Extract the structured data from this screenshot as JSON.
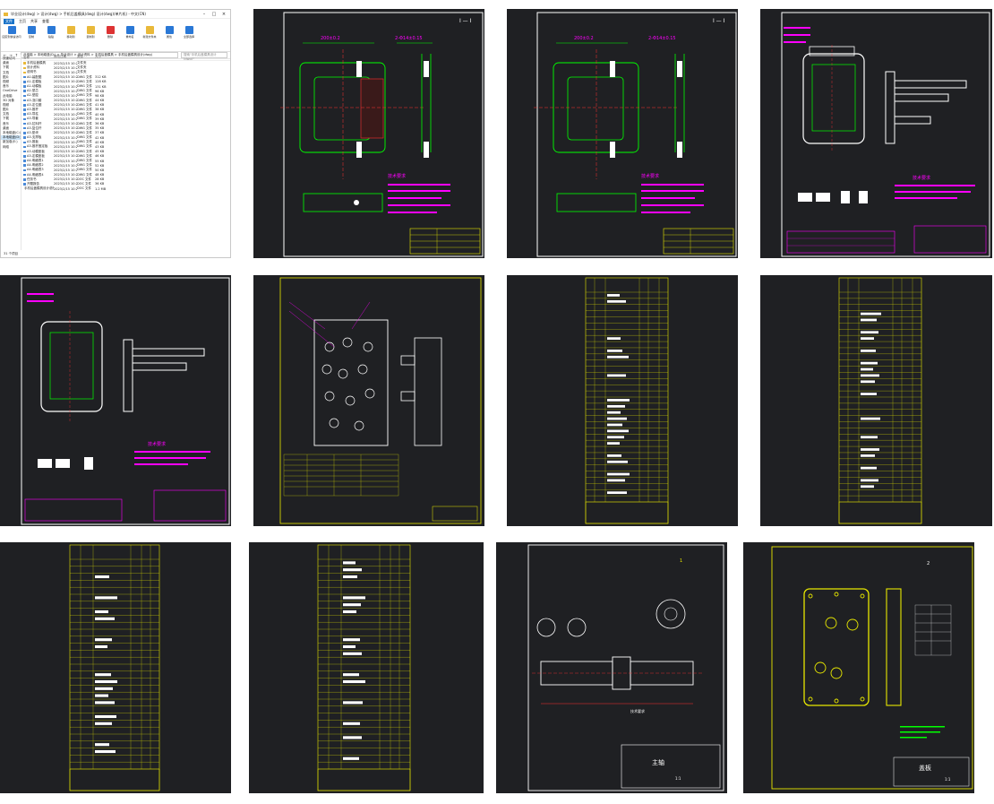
{
  "explorer": {
    "title": "毕业设计(dwg) > 设计(dwg) > 手机后盖模具(dwg) 设计(dwg)(单片机) - 中文(CN)",
    "menu": [
      "文件",
      "主页",
      "共享",
      "查看"
    ],
    "ribbon": [
      "固定到快速访问",
      "复制",
      "粘贴",
      "移动到",
      "复制到",
      "删除",
      "重命名",
      "新建文件夹",
      "属性",
      "全部选择"
    ],
    "address": "此电脑 > 本地磁盘(D:) > 毕业设计 > 设计资料 > 手机后盖模具 > 手机后盖模具设计(dwg)",
    "search_placeholder": "搜索\"手机后盖模具设计(dwg)\"",
    "columns": [
      "名称",
      "修改日期",
      "类型",
      "大小"
    ],
    "nav": [
      "快速访问",
      "桌面",
      "下载",
      "文档",
      "图片",
      "视频",
      "音乐",
      "OneDrive",
      "此电脑",
      "3D 对象",
      "视频",
      "图片",
      "文档",
      "下载",
      "音乐",
      "桌面",
      "本地磁盘(C:)",
      "本地磁盘(D:)",
      "新加卷(E:)",
      "网络"
    ],
    "files": [
      {
        "name": "手机后盖模具",
        "date": "2023/2/15 10:21",
        "type": "文件夹",
        "size": "",
        "kind": "folder"
      },
      {
        "name": "设计资料",
        "date": "2023/2/15 10:21",
        "type": "文件夹",
        "size": "",
        "kind": "folder"
      },
      {
        "name": "说明书",
        "date": "2023/2/15 10:21",
        "type": "文件夹",
        "size": "",
        "kind": "folder"
      },
      {
        "name": "A0-装配图",
        "date": "2023/2/15 10:21",
        "type": "DWG 文件",
        "size": "312 KB",
        "kind": "dwg"
      },
      {
        "name": "A1-定模板",
        "date": "2023/2/15 10:21",
        "type": "DWG 文件",
        "size": "128 KB",
        "kind": "dwg"
      },
      {
        "name": "A1-动模板",
        "date": "2023/2/15 10:21",
        "type": "DWG 文件",
        "size": "131 KB",
        "kind": "dwg"
      },
      {
        "name": "A2-型芯",
        "date": "2023/2/15 10:21",
        "type": "DWG 文件",
        "size": "96 KB",
        "kind": "dwg"
      },
      {
        "name": "A2-型腔",
        "date": "2023/2/15 10:21",
        "type": "DWG 文件",
        "size": "98 KB",
        "kind": "dwg"
      },
      {
        "name": "A3-浇口套",
        "date": "2023/2/15 10:21",
        "type": "DWG 文件",
        "size": "44 KB",
        "kind": "dwg"
      },
      {
        "name": "A3-定位圈",
        "date": "2023/2/15 10:21",
        "type": "DWG 文件",
        "size": "41 KB",
        "kind": "dwg"
      },
      {
        "name": "A3-推杆",
        "date": "2023/2/15 10:21",
        "type": "DWG 文件",
        "size": "38 KB",
        "kind": "dwg"
      },
      {
        "name": "A3-导柱",
        "date": "2023/2/15 10:21",
        "type": "DWG 文件",
        "size": "40 KB",
        "kind": "dwg"
      },
      {
        "name": "A3-导套",
        "date": "2023/2/15 10:21",
        "type": "DWG 文件",
        "size": "39 KB",
        "kind": "dwg"
      },
      {
        "name": "A3-拉料杆",
        "date": "2023/2/15 10:21",
        "type": "DWG 文件",
        "size": "36 KB",
        "kind": "dwg"
      },
      {
        "name": "A3-复位杆",
        "date": "2023/2/15 10:21",
        "type": "DWG 文件",
        "size": "35 KB",
        "kind": "dwg"
      },
      {
        "name": "A3-垫块",
        "date": "2023/2/15 10:21",
        "type": "DWG 文件",
        "size": "37 KB",
        "kind": "dwg"
      },
      {
        "name": "A3-支撑板",
        "date": "2023/2/15 10:21",
        "type": "DWG 文件",
        "size": "42 KB",
        "kind": "dwg"
      },
      {
        "name": "A3-推板",
        "date": "2023/2/15 10:21",
        "type": "DWG 文件",
        "size": "40 KB",
        "kind": "dwg"
      },
      {
        "name": "A3-推杆固定板",
        "date": "2023/2/15 10:21",
        "type": "DWG 文件",
        "size": "43 KB",
        "kind": "dwg"
      },
      {
        "name": "A3-动模座板",
        "date": "2023/2/15 10:21",
        "type": "DWG 文件",
        "size": "45 KB",
        "kind": "dwg"
      },
      {
        "name": "A3-定模座板",
        "date": "2023/2/15 10:21",
        "type": "DWG 文件",
        "size": "46 KB",
        "kind": "dwg"
      },
      {
        "name": "A4-明细表1",
        "date": "2023/2/15 10:21",
        "type": "DWG 文件",
        "size": "55 KB",
        "kind": "dwg"
      },
      {
        "name": "A4-明细表2",
        "date": "2023/2/15 10:21",
        "type": "DWG 文件",
        "size": "52 KB",
        "kind": "dwg"
      },
      {
        "name": "A4-明细表3",
        "date": "2023/2/15 10:21",
        "type": "DWG 文件",
        "size": "50 KB",
        "kind": "dwg"
      },
      {
        "name": "A4-明细表4",
        "date": "2023/2/15 10:21",
        "type": "DWG 文件",
        "size": "48 KB",
        "kind": "dwg"
      },
      {
        "name": "任务书",
        "date": "2023/2/15 10:21",
        "type": "DOC 文件",
        "size": "28 KB",
        "kind": "doc"
      },
      {
        "name": "开题报告",
        "date": "2023/2/15 10:21",
        "type": "DOC 文件",
        "size": "36 KB",
        "kind": "doc"
      },
      {
        "name": "手机后盖模具设计说明书",
        "date": "2023/2/15 10:21",
        "type": "DOC 文件",
        "size": "1.2 MB",
        "kind": "doc"
      }
    ],
    "status": "31 个项目"
  },
  "drawings": {
    "section_label": "Ⅰ — Ⅰ",
    "dim_a": "200±0.2",
    "dim_b": "2-Φ14±0.15",
    "dim_c": "200±0.2",
    "notes_title": "技术要求",
    "shaft_title": "主轴",
    "shaft_scale": "1:1",
    "plate_title": "盖板",
    "plate_scale": "1:1",
    "plate_number": "2",
    "shaft_number": "1",
    "bom_header": [
      "序号",
      "代号",
      "名称及规格",
      "数量",
      "材料",
      "备注"
    ],
    "colors": {
      "bg": "#1f2023",
      "frame": "#ffffff",
      "geom": "#00ff00",
      "dim": "#ff00ff",
      "center": "#ff3030",
      "yellow": "#e8e800"
    }
  }
}
